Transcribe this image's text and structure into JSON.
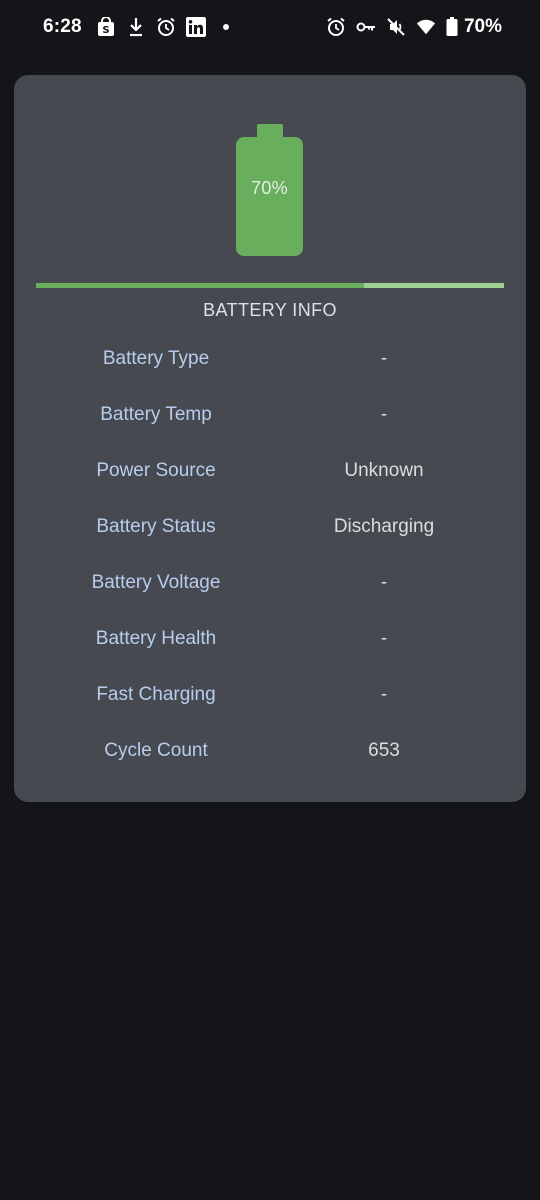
{
  "status_bar": {
    "time": "6:28",
    "battery_percent": "70%",
    "left_icons": [
      "shopping-bag-icon",
      "download-icon",
      "alarm-icon",
      "linkedin-icon",
      "dot-icon"
    ],
    "right_icons": [
      "alarm-icon",
      "vpn-key-icon",
      "mute-icon",
      "wifi-icon",
      "battery-icon"
    ]
  },
  "battery": {
    "percent_label": "70%",
    "level": 0.7,
    "color": "#69ae5c"
  },
  "section_title": "BATTERY INFO",
  "info_rows": [
    {
      "label": "Battery Type",
      "value": "-"
    },
    {
      "label": "Battery Temp",
      "value": "-"
    },
    {
      "label": "Power Source",
      "value": "Unknown"
    },
    {
      "label": "Battery Status",
      "value": "Discharging"
    },
    {
      "label": "Battery Voltage",
      "value": "-"
    },
    {
      "label": "Battery Health",
      "value": "-"
    },
    {
      "label": "Fast Charging",
      "value": "-"
    },
    {
      "label": "Cycle Count",
      "value": "653"
    }
  ]
}
